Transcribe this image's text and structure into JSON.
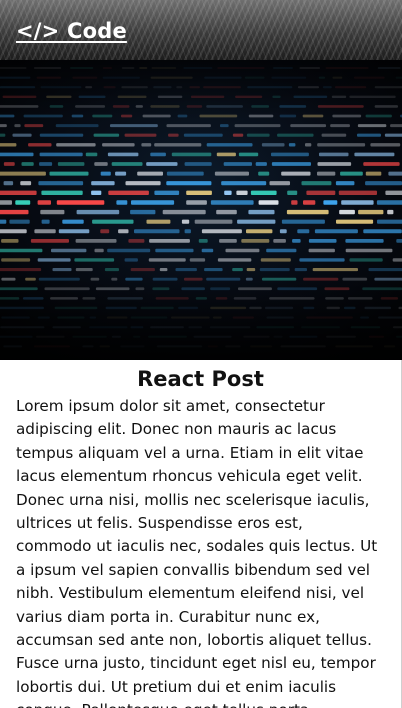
{
  "header": {
    "link_label": "</> Code"
  },
  "hero": {
    "image": "code-editor-screenshot"
  },
  "post": {
    "title": "React Post",
    "body": "Lorem ipsum dolor sit amet, consectetur adipiscing elit. Donec non mauris ac lacus tempus aliquam vel a urna. Etiam in elit vitae lacus elementum rhoncus vehicula eget velit. Donec urna nisi, mollis nec scelerisque iaculis, ultrices ut felis. Suspendisse eros est, commodo ut iaculis nec, sodales quis lectus. Ut a ipsum vel sapien convallis bibendum sed vel nibh. Vestibulum elementum eleifend nisi, vel varius diam porta in. Curabitur nunc ex, accumsan sed ante non, lobortis aliquet tellus. Fusce urna justo, tincidunt eget nisl eu, tempor lobortis dui. Ut pretium dui et enim iaculis congue. Pellentesque eget tellus porta,"
  },
  "colors": {
    "header_text": "#ffffff",
    "body_text": "#111111",
    "code_blue": "#3fa9f5",
    "code_teal": "#38d6c0",
    "code_red": "#ff4a4a",
    "code_white": "#e8ecf2"
  }
}
